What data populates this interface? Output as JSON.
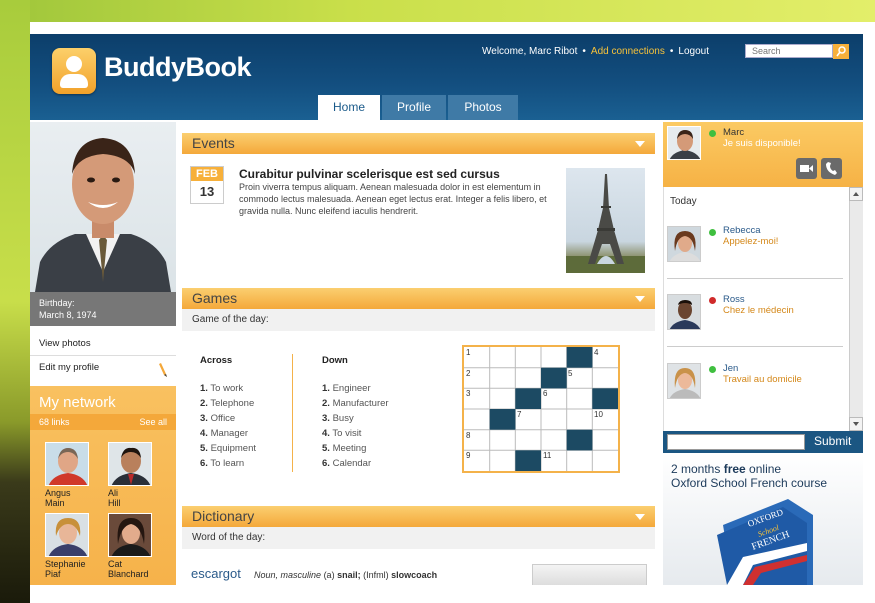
{
  "header": {
    "logo_text": "BuddyBook",
    "welcome": "Welcome, Marc Ribot",
    "add_connections": "Add connections",
    "logout": "Logout",
    "search_placeholder": "Search",
    "tabs": [
      "Home",
      "Profile",
      "Photos"
    ],
    "active_tab": "Home"
  },
  "profile": {
    "birthday_label": "Birthday:",
    "birthday_value": "March 8, 1974",
    "view_photos": "View photos",
    "edit_profile": "Edit my profile"
  },
  "network": {
    "title": "My network",
    "links_count": "68 links",
    "see_all": "See all",
    "friends": [
      {
        "first": "Angus",
        "last": "Main"
      },
      {
        "first": "Ali",
        "last": "Hill"
      },
      {
        "first": "Stephanie",
        "last": "Piaf"
      },
      {
        "first": "Cat",
        "last": "Blanchard"
      }
    ]
  },
  "events": {
    "title": "Events",
    "month": "FEB",
    "day": "13",
    "event_title": "Curabitur pulvinar scelerisque est sed cursus",
    "event_body": "Proin viverra tempus aliquam. Aenean malesuada dolor in est elementum in commodo lectus malesuada. Aenean eget lectus erat. Integer a felis libero, et gravida nulla. Nunc eleifend iaculis hendrerit."
  },
  "games": {
    "title": "Games",
    "subtitle": "Game of the day:",
    "across_title": "Across",
    "down_title": "Down",
    "across": [
      {
        "n": "1.",
        "clue": "To work"
      },
      {
        "n": "2.",
        "clue": "Telephone"
      },
      {
        "n": "3.",
        "clue": "Office"
      },
      {
        "n": "4.",
        "clue": "Manager"
      },
      {
        "n": "5.",
        "clue": "Equipment"
      },
      {
        "n": "6.",
        "clue": "To learn"
      }
    ],
    "down": [
      {
        "n": "1.",
        "clue": "Engineer"
      },
      {
        "n": "2.",
        "clue": "Manufacturer"
      },
      {
        "n": "3.",
        "clue": "Busy"
      },
      {
        "n": "4.",
        "clue": "To visit"
      },
      {
        "n": "5.",
        "clue": "Meeting"
      },
      {
        "n": "6.",
        "clue": "Calendar"
      }
    ],
    "grid_numbers": [
      "1",
      "4",
      "2",
      "5",
      "3",
      "6",
      "7",
      "10",
      "8",
      "9",
      "11"
    ]
  },
  "dictionary": {
    "title": "Dictionary",
    "subtitle": "Word of the day:",
    "word": "escargot",
    "pos": "Noun, masculine",
    "def_a": "(a)",
    "def_b": "snail;",
    "def_c": "(Infml)",
    "def_d": "slowcoach"
  },
  "chat": {
    "me_name": "Marc",
    "me_status": "Je suis disponible!",
    "today": "Today",
    "contacts": [
      {
        "name": "Rebecca",
        "status": "Appelez-moi!",
        "presence": "online"
      },
      {
        "name": "Ross",
        "status": "Chez le médecin",
        "presence": "busy"
      },
      {
        "name": "Jen",
        "status": "Travail au domicile",
        "presence": "online"
      }
    ],
    "submit": "Submit"
  },
  "ad": {
    "line1_pre": "2 months ",
    "line1_bold": "free",
    "line1_post": " online",
    "line2": "Oxford School French course",
    "book_brand": "OXFORD",
    "book_sub": "School",
    "book_title": "FRENCH"
  },
  "colors": {
    "header_blue": "#134f80",
    "accent_orange": "#f4a83a",
    "link_gold": "#f7c23a",
    "crossword_block": "#1c4a63"
  }
}
